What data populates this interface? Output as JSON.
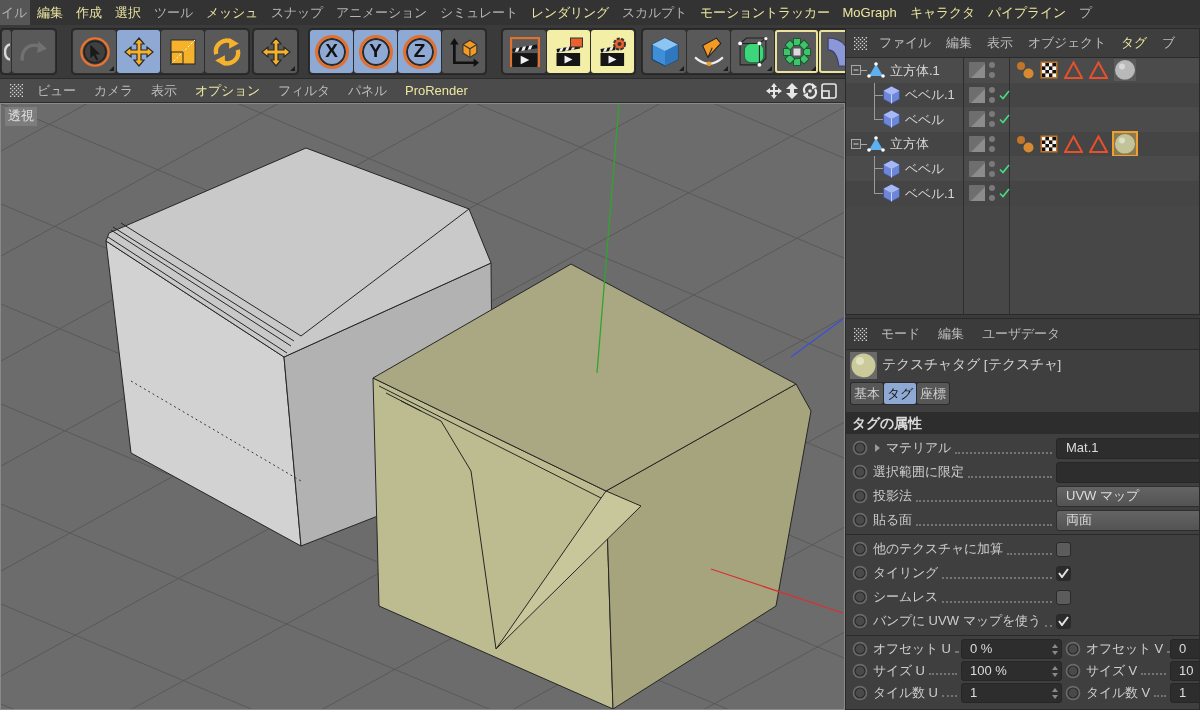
{
  "menu_bar": [
    {
      "label": "イル",
      "selected": true,
      "highlighted": false
    },
    {
      "label": "編集",
      "selected": false,
      "highlighted": true
    },
    {
      "label": "作成",
      "selected": false,
      "highlighted": true
    },
    {
      "label": "選択",
      "selected": false,
      "highlighted": true
    },
    {
      "label": "ツール",
      "selected": false,
      "highlighted": false
    },
    {
      "label": "メッシュ",
      "selected": false,
      "highlighted": true
    },
    {
      "label": "スナップ",
      "selected": false,
      "highlighted": false
    },
    {
      "label": "アニメーション",
      "selected": false,
      "highlighted": false
    },
    {
      "label": "シミュレート",
      "selected": false,
      "highlighted": false
    },
    {
      "label": "レンダリング",
      "selected": false,
      "highlighted": true
    },
    {
      "label": "スカルプト",
      "selected": false,
      "highlighted": false
    },
    {
      "label": "モーショントラッカー",
      "selected": false,
      "highlighted": true
    },
    {
      "label": "MoGraph",
      "selected": false,
      "highlighted": true
    },
    {
      "label": "キャラクタ",
      "selected": false,
      "highlighted": true
    },
    {
      "label": "パイプライン",
      "selected": false,
      "highlighted": true
    },
    {
      "label": "プ",
      "selected": false,
      "highlighted": false
    }
  ],
  "toolbar": {
    "groups": [
      {
        "buttons": [
          {
            "kind": "undo",
            "selected": false,
            "highlighted": false,
            "framed": false,
            "submenu": false,
            "disabled": false
          },
          {
            "kind": "redo",
            "selected": false,
            "highlighted": false,
            "framed": false,
            "submenu": false,
            "disabled": true
          }
        ]
      },
      {
        "buttons": [
          {
            "kind": "select",
            "selected": false,
            "highlighted": false,
            "framed": false,
            "submenu": true,
            "disabled": false
          },
          {
            "kind": "move",
            "selected": true,
            "highlighted": false,
            "framed": false,
            "submenu": false,
            "disabled": false
          },
          {
            "kind": "scale",
            "selected": false,
            "highlighted": false,
            "framed": false,
            "submenu": false,
            "disabled": false
          },
          {
            "kind": "rotate",
            "selected": false,
            "highlighted": false,
            "framed": false,
            "submenu": false,
            "disabled": false
          }
        ]
      },
      {
        "buttons": [
          {
            "kind": "move",
            "selected": false,
            "highlighted": false,
            "framed": false,
            "submenu": true,
            "disabled": false
          }
        ]
      },
      {
        "buttons": [
          {
            "kind": "axis",
            "label": "X",
            "selected": true,
            "highlighted": false,
            "framed": false,
            "submenu": false,
            "disabled": false
          },
          {
            "kind": "axis",
            "label": "Y",
            "selected": true,
            "highlighted": false,
            "framed": false,
            "submenu": false,
            "disabled": false
          },
          {
            "kind": "axis",
            "label": "Z",
            "selected": true,
            "highlighted": false,
            "framed": false,
            "submenu": false,
            "disabled": false
          },
          {
            "kind": "coordinate_system",
            "selected": false,
            "highlighted": false,
            "framed": false,
            "submenu": false,
            "disabled": false
          }
        ]
      },
      {
        "buttons": [
          {
            "kind": "render_view",
            "selected": false,
            "highlighted": false,
            "framed": false,
            "submenu": false,
            "disabled": false
          },
          {
            "kind": "render_picture_viewer",
            "selected": false,
            "highlighted": true,
            "framed": false,
            "submenu": false,
            "disabled": false
          },
          {
            "kind": "render_settings",
            "selected": false,
            "highlighted": true,
            "framed": false,
            "submenu": false,
            "disabled": false
          }
        ]
      },
      {
        "buttons": [
          {
            "kind": "cube",
            "selected": false,
            "highlighted": false,
            "framed": false,
            "submenu": true,
            "disabled": false
          },
          {
            "kind": "pen",
            "selected": false,
            "highlighted": false,
            "framed": false,
            "submenu": true,
            "disabled": false
          },
          {
            "kind": "subdivision",
            "selected": false,
            "highlighted": false,
            "framed": false,
            "submenu": true,
            "disabled": false
          },
          {
            "kind": "cloner",
            "selected": false,
            "highlighted": false,
            "framed": true,
            "submenu": true,
            "disabled": false
          },
          {
            "kind": "bend",
            "selected": false,
            "highlighted": false,
            "framed": true,
            "submenu": false,
            "disabled": false
          }
        ]
      }
    ]
  },
  "viewport": {
    "menu": [
      {
        "label": "ビュー",
        "highlighted": false
      },
      {
        "label": "カメラ",
        "highlighted": false
      },
      {
        "label": "表示",
        "highlighted": false
      },
      {
        "label": "オプション",
        "highlighted": true
      },
      {
        "label": "フィルタ",
        "highlighted": false
      },
      {
        "label": "パネル",
        "highlighted": false
      },
      {
        "label": "ProRender",
        "highlighted": true
      }
    ],
    "view_label": "透視"
  },
  "object_manager": {
    "menu": [
      {
        "label": "ファイル",
        "highlighted": false
      },
      {
        "label": "編集",
        "highlighted": false
      },
      {
        "label": "表示",
        "highlighted": false
      },
      {
        "label": "オブジェクト",
        "highlighted": false
      },
      {
        "label": "タグ",
        "highlighted": true
      },
      {
        "label": "ブ",
        "highlighted": false
      }
    ],
    "objects": [
      {
        "name": "立方体.1",
        "kind": "polygon",
        "expanded": true,
        "tags": [
          {
            "kind": "dots",
            "selected": false
          },
          {
            "kind": "checker",
            "selected": false
          },
          {
            "kind": "selection",
            "selected": false
          },
          {
            "kind": "selection",
            "selected": false
          },
          {
            "kind": "material",
            "selected": false,
            "color": "#b9b9b9"
          }
        ],
        "children": [
          {
            "name": "ベベル.1",
            "kind": "bevel",
            "enabled": true
          },
          {
            "name": "ベベル",
            "kind": "bevel",
            "enabled": true
          }
        ]
      },
      {
        "name": "立方体",
        "kind": "polygon",
        "expanded": true,
        "tags": [
          {
            "kind": "dots",
            "selected": false
          },
          {
            "kind": "checker",
            "selected": false
          },
          {
            "kind": "selection",
            "selected": false
          },
          {
            "kind": "selection",
            "selected": false
          },
          {
            "kind": "material",
            "selected": true,
            "color": "#c3c39a"
          }
        ],
        "children": [
          {
            "name": "ベベル",
            "kind": "bevel",
            "enabled": true
          },
          {
            "name": "ベベル.1",
            "kind": "bevel",
            "enabled": true
          }
        ]
      }
    ]
  },
  "attribute_manager": {
    "menu": [
      {
        "label": "モード",
        "highlighted": false
      },
      {
        "label": "編集",
        "highlighted": false
      },
      {
        "label": "ユーザデータ",
        "highlighted": false
      }
    ],
    "title": "テクスチャタグ [テクスチャ]",
    "tabs": [
      {
        "label": "基本",
        "selected": false
      },
      {
        "label": "タグ",
        "selected": true
      },
      {
        "label": "座標",
        "selected": false
      }
    ],
    "section": "タグの属性",
    "param_groups": [
      {
        "params": [
          {
            "kind": "material_link",
            "label": "マテリアル",
            "value": "Mat.1"
          },
          {
            "kind": "link",
            "label": "選択範囲に限定"
          },
          {
            "kind": "dropdown",
            "label": "投影法",
            "value": "UVW マップ"
          },
          {
            "kind": "dropdown",
            "label": "貼る面",
            "value": "両面"
          }
        ]
      },
      {
        "params": [
          {
            "kind": "checkbox",
            "label": "他のテクスチャに加算",
            "checked": false
          },
          {
            "kind": "checkbox",
            "label": "タイリング",
            "checked": true
          },
          {
            "kind": "checkbox",
            "label": "シームレス",
            "checked": false
          },
          {
            "kind": "checkbox",
            "label": "バンプに UVW マップを使う",
            "checked": true
          }
        ]
      },
      {
        "params": [
          {
            "kind": "number_pair",
            "left": {
              "label": "オフセット U",
              "value": "0 %"
            },
            "right": {
              "label": "オフセット V",
              "value": "0"
            }
          },
          {
            "kind": "number_pair",
            "left": {
              "label": "サイズ U",
              "value": "100 %"
            },
            "right": {
              "label": "サイズ V",
              "value": "10"
            }
          },
          {
            "kind": "number_pair",
            "left": {
              "label": "タイル数 U",
              "value": "1"
            },
            "right": {
              "label": "タイル数 V",
              "value": "1"
            }
          }
        ]
      }
    ]
  }
}
